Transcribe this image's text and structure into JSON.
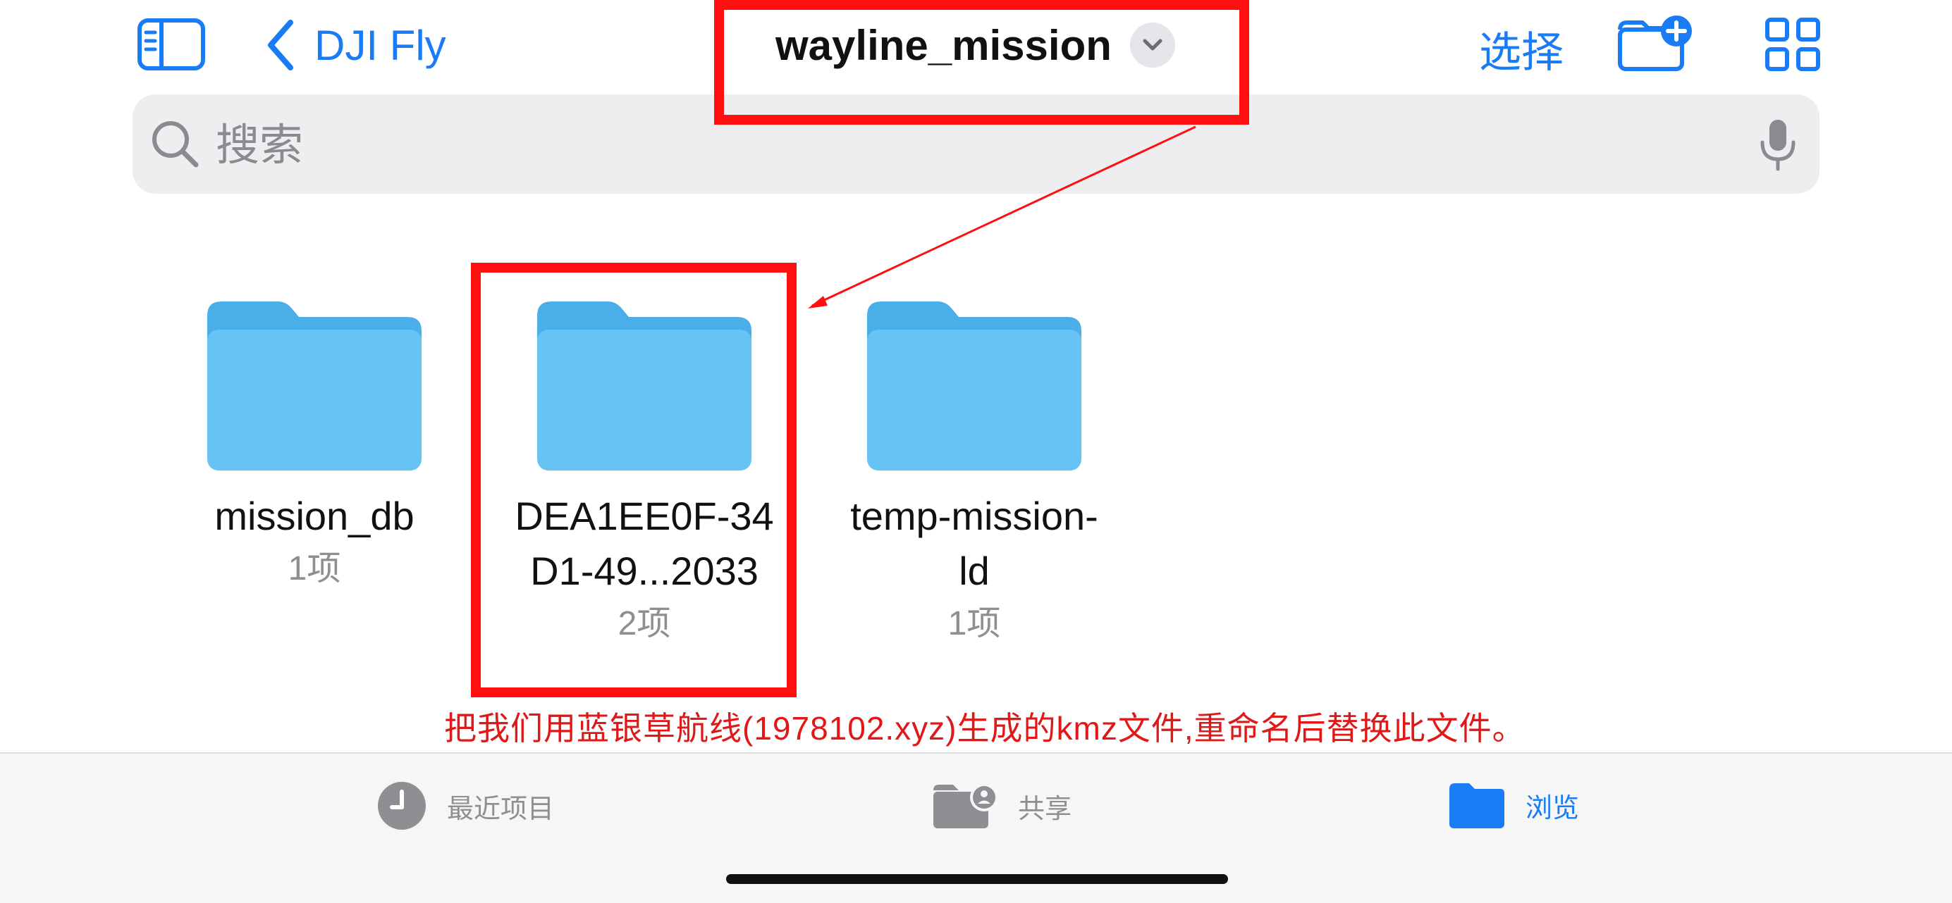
{
  "header": {
    "back_label": "DJI Fly",
    "title": "wayline_mission",
    "select_label": "选择"
  },
  "search": {
    "placeholder": "搜索"
  },
  "folders": [
    {
      "name_line1": "mission_db",
      "name_line2": "",
      "count": "1项"
    },
    {
      "name_line1": "DEA1EE0F-34",
      "name_line2": "D1-49...2033",
      "count": "2项"
    },
    {
      "name_line1": "temp-mission-",
      "name_line2": "ld",
      "count": "1项"
    }
  ],
  "annotation": {
    "text": "把我们用蓝银草航线(1978102.xyz)生成的kmz文件,重命名后替换此文件。",
    "color": "#ff1010"
  },
  "tabbar": {
    "tabs": [
      {
        "label": "最近项目",
        "icon": "clock-icon",
        "active": false
      },
      {
        "label": "共享",
        "icon": "shared-folder-icon",
        "active": false
      },
      {
        "label": "浏览",
        "icon": "folder-icon",
        "active": true
      }
    ]
  },
  "colors": {
    "accent": "#1a7cf5",
    "folder_top": "#4aaee8",
    "folder_body": "#66c3f4",
    "tab_inactive": "#8e8e93"
  }
}
